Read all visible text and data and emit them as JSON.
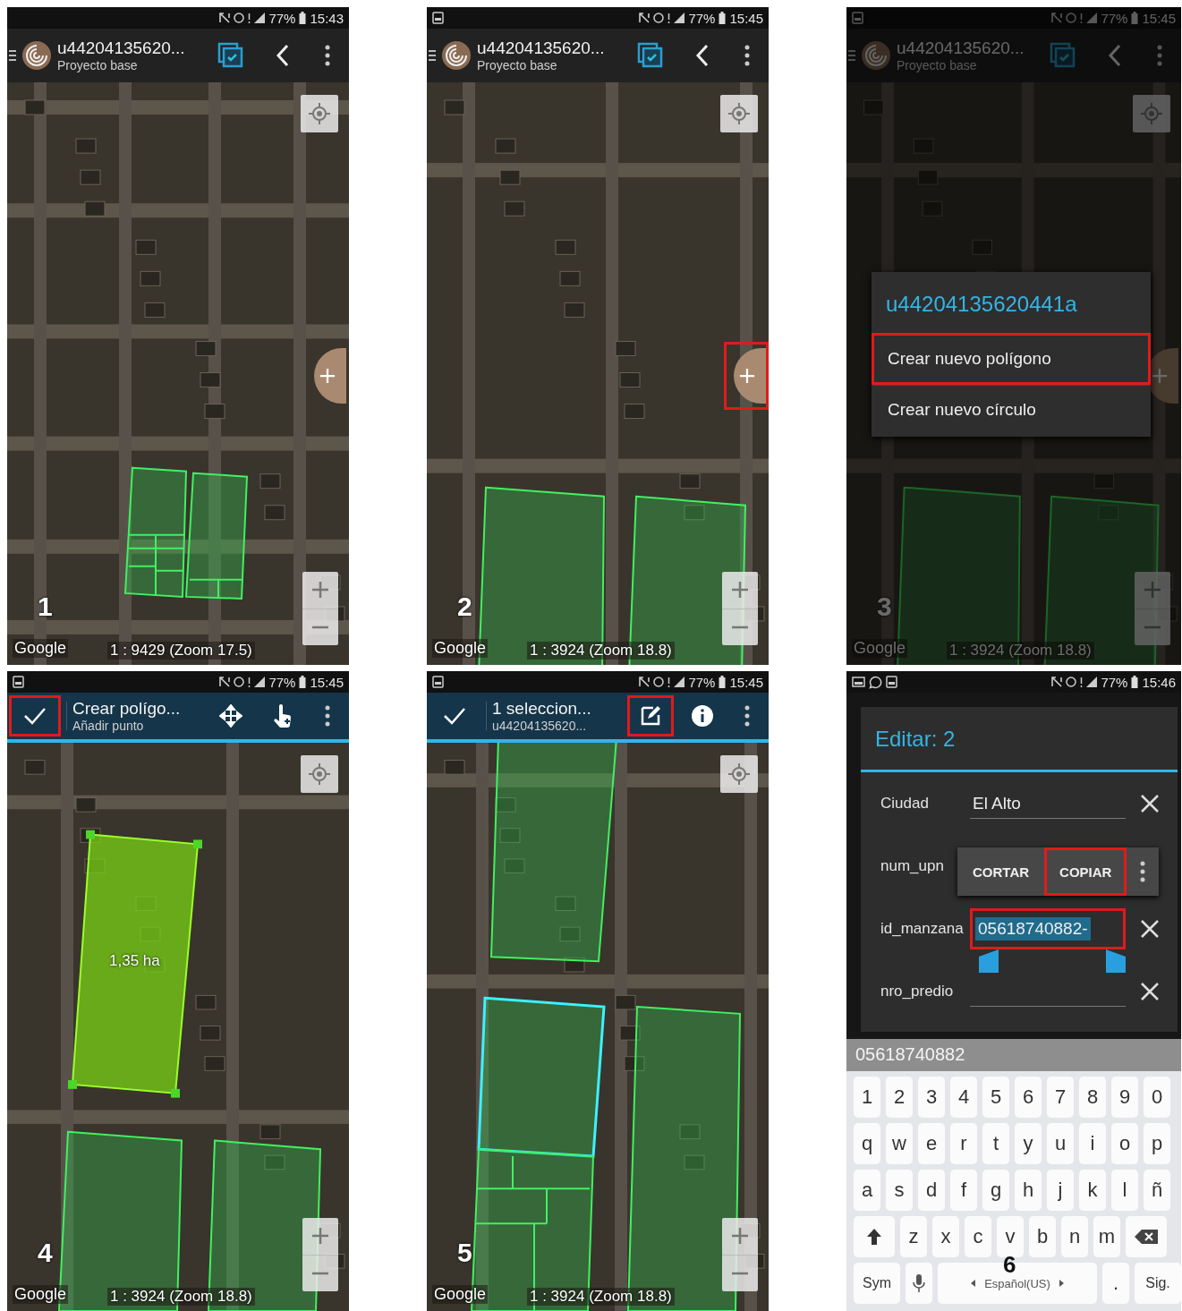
{
  "panels": [
    {
      "kind": "map",
      "number": "1",
      "dimmed": false,
      "status": {
        "battery": "77%",
        "time": "15:43"
      },
      "toolbar": {
        "kind": "project",
        "title": "u44204135620...",
        "subtitle": "Proyecto base",
        "actions": [
          {
            "kind": "layers",
            "highlighted": false
          },
          {
            "kind": "back",
            "highlighted": false
          },
          {
            "kind": "more",
            "highlighted": false
          }
        ]
      },
      "map": {
        "kind": "overview",
        "attribution": "Google",
        "scale": "1 : 9429 (Zoom 17.5)"
      },
      "add_button": {
        "highlighted": false
      }
    },
    {
      "kind": "map",
      "number": "2",
      "dimmed": false,
      "status": {
        "notification_icons": [
          {
            "kind": "screenshot"
          }
        ],
        "battery": "77%",
        "time": "15:45"
      },
      "toolbar": {
        "kind": "project",
        "title": "u44204135620...",
        "subtitle": "Proyecto base",
        "actions": [
          {
            "kind": "layers",
            "highlighted": false
          },
          {
            "kind": "back",
            "highlighted": false
          },
          {
            "kind": "more",
            "highlighted": false
          }
        ]
      },
      "map": {
        "kind": "close",
        "attribution": "Google",
        "scale": "1 : 3924 (Zoom 18.8)"
      },
      "add_button": {
        "highlighted": true
      }
    },
    {
      "kind": "map",
      "number": "3",
      "dimmed": true,
      "status": {
        "notification_icons": [
          {
            "kind": "screenshot"
          }
        ],
        "battery": "77%",
        "time": "15:45"
      },
      "toolbar": {
        "kind": "project",
        "title": "u44204135620...",
        "subtitle": "Proyecto base",
        "actions": [
          {
            "kind": "layers",
            "highlighted": false
          },
          {
            "kind": "back",
            "highlighted": false
          },
          {
            "kind": "more",
            "highlighted": false
          }
        ]
      },
      "map": {
        "kind": "close",
        "attribution": "Google",
        "scale": "1 : 3924 (Zoom 18.8)"
      },
      "add_button": {
        "highlighted": false
      },
      "menu": {
        "title": "u44204135620441a",
        "items": [
          {
            "label": "Crear nuevo polígono",
            "highlighted": true
          },
          {
            "label": "Crear nuevo círculo",
            "highlighted": false
          }
        ]
      }
    },
    {
      "kind": "map",
      "number": "4",
      "dimmed": false,
      "status": {
        "notification_icons": [
          {
            "kind": "screenshot"
          }
        ],
        "battery": "77%",
        "time": "15:45"
      },
      "toolbar": {
        "kind": "action",
        "confirm_highlighted": true,
        "title": "Crear polígo...",
        "subtitle": "Añadir punto",
        "actions": [
          {
            "kind": "move",
            "highlighted": false
          },
          {
            "kind": "touch",
            "highlighted": false
          },
          {
            "kind": "more",
            "highlighted": false
          }
        ]
      },
      "map": {
        "kind": "drawing",
        "attribution": "Google",
        "scale": "1 : 3924 (Zoom 18.8)",
        "area_label": "1,35 ha"
      }
    },
    {
      "kind": "map",
      "number": "5",
      "dimmed": false,
      "status": {
        "notification_icons": [
          {
            "kind": "screenshot"
          }
        ],
        "battery": "77%",
        "time": "15:45"
      },
      "toolbar": {
        "kind": "action",
        "confirm_highlighted": false,
        "title": "1 seleccion...",
        "subtitle": "u44204135620...",
        "actions": [
          {
            "kind": "edit",
            "highlighted": true
          },
          {
            "kind": "info",
            "highlighted": false
          },
          {
            "kind": "more",
            "highlighted": false
          }
        ]
      },
      "map": {
        "kind": "selection",
        "attribution": "Google",
        "scale": "1 : 3924 (Zoom 18.8)"
      }
    },
    {
      "kind": "form",
      "number": "6",
      "status": {
        "notification_icons": [
          {
            "kind": "gallery"
          },
          {
            "kind": "chat"
          },
          {
            "kind": "screenshot"
          }
        ],
        "battery": "77%",
        "time": "15:46"
      },
      "dialog": {
        "title": "Editar: 2",
        "fields": [
          {
            "label": "Ciudad",
            "value": "El Alto",
            "selected": false,
            "highlighted": false
          },
          {
            "label": "num_upn",
            "selected": false,
            "highlighted": false,
            "context_menu": [
              {
                "label": "CORTAR",
                "highlighted": false
              },
              {
                "label": "COPIAR",
                "highlighted": true
              }
            ]
          },
          {
            "label": "id_manzana",
            "value": "05618740882-",
            "selected": true,
            "highlighted": true
          },
          {
            "label": "nro_predio",
            "selected": false,
            "highlighted": false
          }
        ]
      },
      "keyboard": {
        "suggestion": "05618740882",
        "rows": [
          {
            "keys": [
              {
                "kind": "char",
                "label": "1"
              },
              {
                "kind": "char",
                "label": "2"
              },
              {
                "kind": "char",
                "label": "3"
              },
              {
                "kind": "char",
                "label": "4"
              },
              {
                "kind": "char",
                "label": "5"
              },
              {
                "kind": "char",
                "label": "6"
              },
              {
                "kind": "char",
                "label": "7"
              },
              {
                "kind": "char",
                "label": "8"
              },
              {
                "kind": "char",
                "label": "9"
              },
              {
                "kind": "char",
                "label": "0"
              }
            ]
          },
          {
            "keys": [
              {
                "kind": "char",
                "label": "q"
              },
              {
                "kind": "char",
                "label": "w"
              },
              {
                "kind": "char",
                "label": "e"
              },
              {
                "kind": "char",
                "label": "r"
              },
              {
                "kind": "char",
                "label": "t"
              },
              {
                "kind": "char",
                "label": "y"
              },
              {
                "kind": "char",
                "label": "u"
              },
              {
                "kind": "char",
                "label": "i"
              },
              {
                "kind": "char",
                "label": "o"
              },
              {
                "kind": "char",
                "label": "p"
              }
            ]
          },
          {
            "keys": [
              {
                "kind": "char",
                "label": "a"
              },
              {
                "kind": "char",
                "label": "s"
              },
              {
                "kind": "char",
                "label": "d"
              },
              {
                "kind": "char",
                "label": "f"
              },
              {
                "kind": "char",
                "label": "g"
              },
              {
                "kind": "char",
                "label": "h"
              },
              {
                "kind": "char",
                "label": "j"
              },
              {
                "kind": "char",
                "label": "k"
              },
              {
                "kind": "char",
                "label": "l"
              },
              {
                "kind": "char",
                "label": "ñ"
              }
            ]
          },
          {
            "keys": [
              {
                "kind": "shift"
              },
              {
                "kind": "char",
                "label": "z"
              },
              {
                "kind": "char",
                "label": "x"
              },
              {
                "kind": "char",
                "label": "c"
              },
              {
                "kind": "char",
                "label": "v"
              },
              {
                "kind": "char",
                "label": "b"
              },
              {
                "kind": "char",
                "label": "n"
              },
              {
                "kind": "char",
                "label": "m"
              },
              {
                "kind": "backspace"
              }
            ]
          },
          {
            "keys": [
              {
                "kind": "wide",
                "label": "Sym"
              },
              {
                "kind": "mic"
              },
              {
                "kind": "space",
                "label": "Español(US)"
              },
              {
                "kind": "char",
                "label": "."
              },
              {
                "kind": "wide",
                "label": "Sig."
              }
            ]
          }
        ]
      }
    }
  ]
}
